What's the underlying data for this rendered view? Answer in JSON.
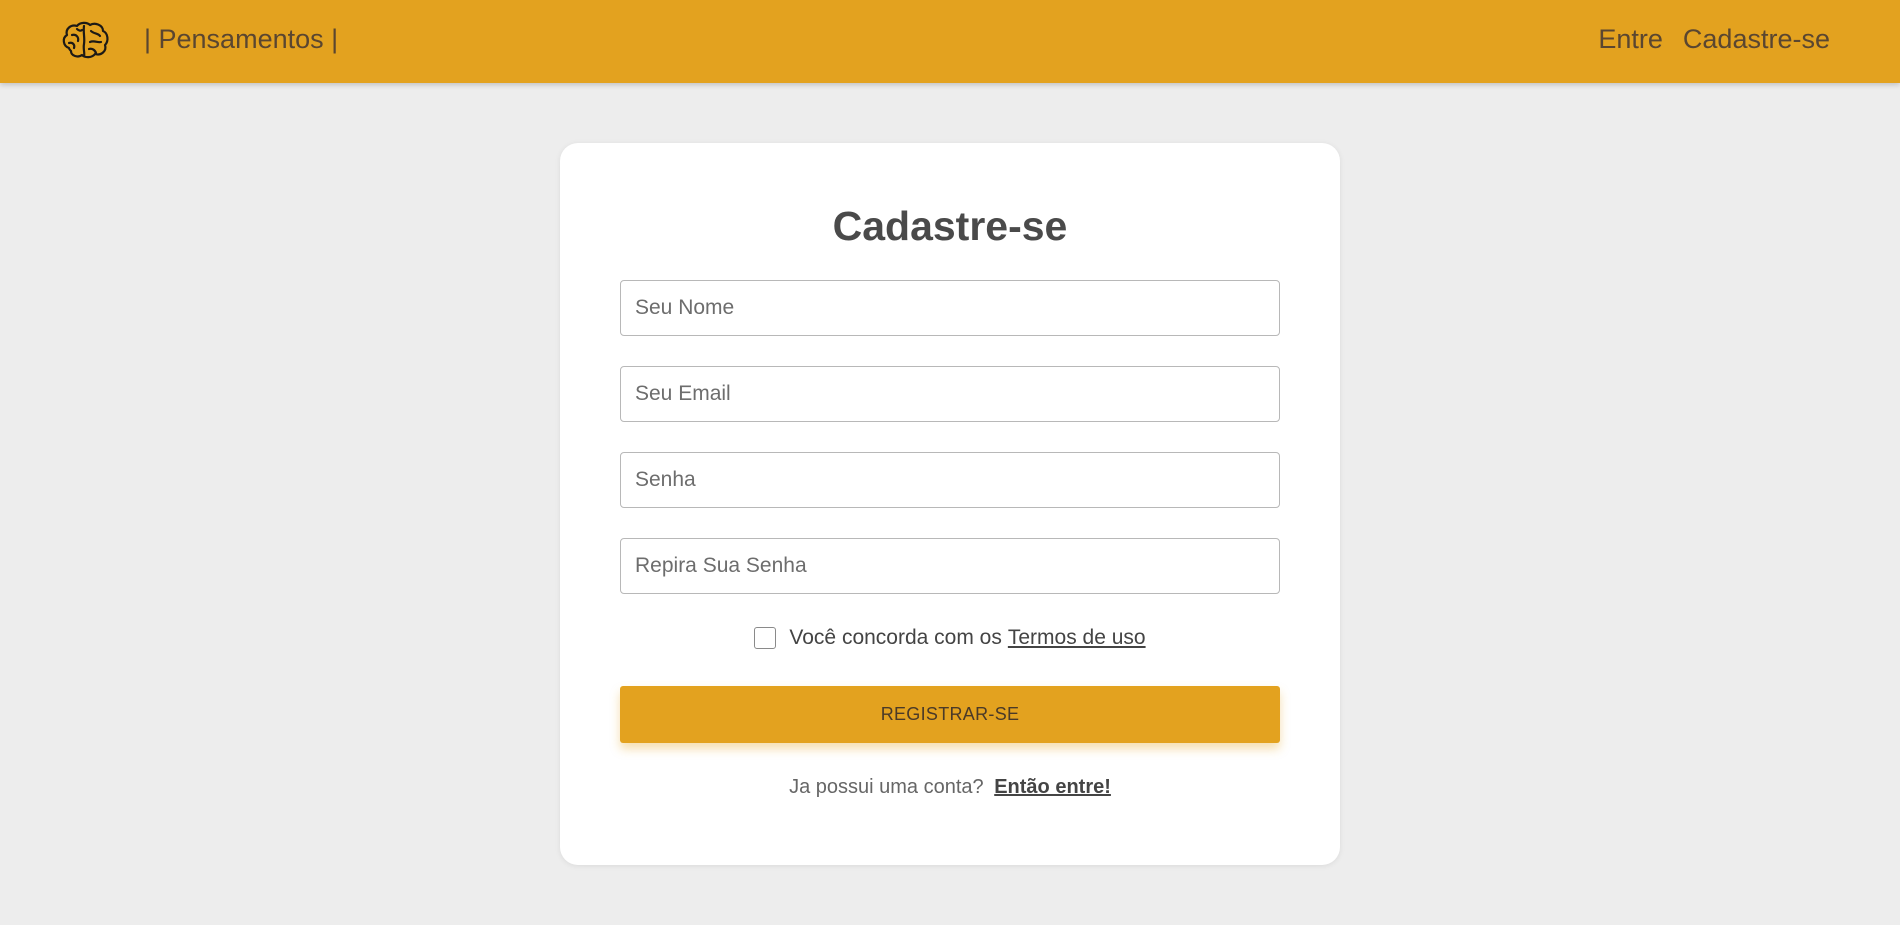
{
  "header": {
    "logo_icon": "brain-icon",
    "brand": "| Pensamentos |",
    "nav": [
      {
        "label": "Entre"
      },
      {
        "label": "Cadastre-se"
      }
    ]
  },
  "form": {
    "title": "Cadastre-se",
    "fields": [
      {
        "placeholder": "Seu Nome",
        "value": ""
      },
      {
        "placeholder": "Seu Email",
        "value": ""
      },
      {
        "placeholder": "Senha",
        "value": ""
      },
      {
        "placeholder": "Repira Sua Senha",
        "value": ""
      }
    ],
    "terms": {
      "checked": false,
      "text": "Você concorda com os",
      "link": "Termos de uso"
    },
    "submit_label": "REGISTRAR-SE",
    "login_prompt": "Ja possui uma conta?",
    "login_link": "Então entre!"
  },
  "colors": {
    "accent": "#e3a21f",
    "background": "#ededed",
    "card": "#ffffff"
  }
}
